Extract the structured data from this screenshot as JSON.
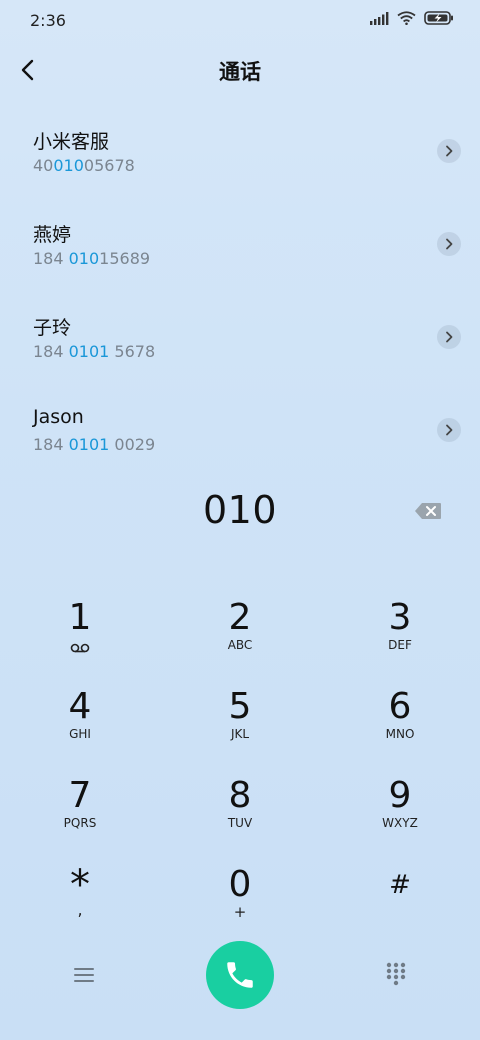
{
  "status_bar": {
    "time": "2:36"
  },
  "header": {
    "title": "通话"
  },
  "contacts": [
    {
      "name": "小米客服",
      "number_parts": [
        "40",
        "010",
        "05678"
      ]
    },
    {
      "name": "燕婷",
      "number_parts": [
        "184 ",
        "010",
        "15689"
      ]
    },
    {
      "name": "子玲",
      "number_parts": [
        "184 ",
        "0101",
        " 5678"
      ]
    },
    {
      "name": "Jason",
      "number_parts": [
        "184 ",
        "0101",
        " 0029"
      ]
    }
  ],
  "dialer": {
    "number": "010"
  },
  "keypad": {
    "keys": [
      {
        "digit": "1",
        "letters": ""
      },
      {
        "digit": "2",
        "letters": "ABC"
      },
      {
        "digit": "3",
        "letters": "DEF"
      },
      {
        "digit": "4",
        "letters": "GHI"
      },
      {
        "digit": "5",
        "letters": "JKL"
      },
      {
        "digit": "6",
        "letters": "MNO"
      },
      {
        "digit": "7",
        "letters": "PQRS"
      },
      {
        "digit": "8",
        "letters": "TUV"
      },
      {
        "digit": "9",
        "letters": "WXYZ"
      },
      {
        "digit": "*",
        "letters": ","
      },
      {
        "digit": "0",
        "letters": "+"
      },
      {
        "digit": "#",
        "letters": ""
      }
    ]
  },
  "colors": {
    "highlight": "#1a97d8",
    "call_button": "#19cfa1",
    "secondary_text": "#7b8590"
  },
  "icons": {
    "back": "back-arrow-icon",
    "arrow": "chevron-right-icon",
    "backspace": "backspace-icon",
    "voicemail": "voicemail-icon",
    "menu": "menu-icon",
    "call": "phone-icon",
    "keypad": "dialpad-icon"
  }
}
